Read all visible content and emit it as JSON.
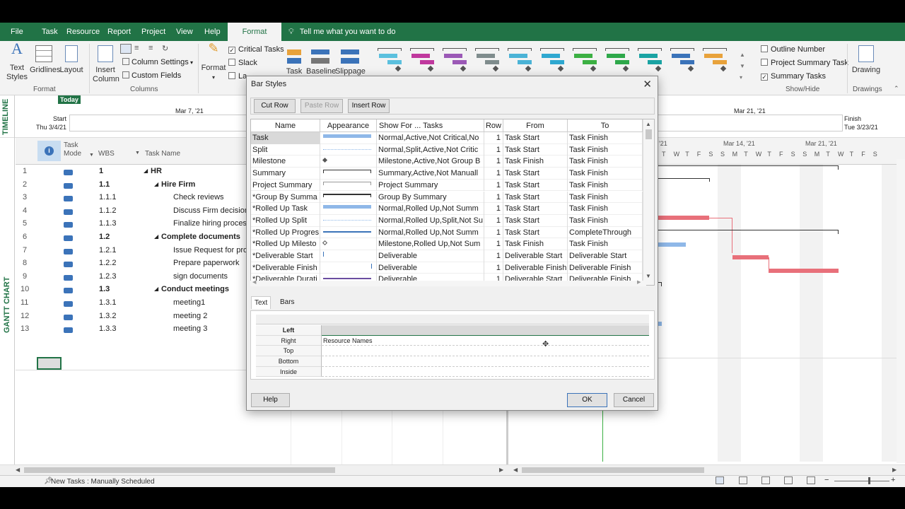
{
  "ribbon_tabs": [
    "File",
    "Task",
    "Resource",
    "Report",
    "Project",
    "View",
    "Help",
    "Format"
  ],
  "active_tab": "Format",
  "tell_me": "Tell me what you want to do",
  "ribbon": {
    "text_styles": "Text Styles",
    "gridlines": "Gridlines",
    "layout": "Layout",
    "insert_column": "Insert Column",
    "column_settings": "Column Settings",
    "custom_fields": "Custom Fields",
    "format": "Format",
    "critical_tasks": "Critical Tasks",
    "slack": "Slack",
    "late_tasks": "La",
    "task": "Task",
    "baseline": "Baseline",
    "slippage": "Slippage",
    "outline_number": "Outline Number",
    "project_summary_task": "Project Summary Task",
    "summary_tasks": "Summary Tasks",
    "drawing": "Drawing",
    "group_format": "Format",
    "group_columns": "Columns",
    "group_showhide": "Show/Hide",
    "group_drawings": "Drawings",
    "gantt_colors": [
      "#5bc0de",
      "#c0399e",
      "#9b59b6",
      "#7f8c8d",
      "#4bb3d6",
      "#2fa8d0",
      "#3cb043",
      "#2ea84a",
      "#1aa3a3",
      "#3b73b9",
      "#e8a23b"
    ]
  },
  "timeline": {
    "label": "TIMELINE",
    "today": "Today",
    "start_label": "Start",
    "start_date": "Thu 3/4/21",
    "mar7": "Mar 7, '21",
    "mar21": "Mar 21, '21",
    "finish_label": "Finish",
    "finish_date": "Tue 3/23/21"
  },
  "gantt_label": "GANTT CHART",
  "grid": {
    "headers": {
      "task_mode": "Task Mode",
      "wbs": "WBS",
      "task_name": "Task Name"
    },
    "rows": [
      {
        "id": "1",
        "wbs": "1",
        "name": "HR",
        "bold": true,
        "indent": 0,
        "summary": true
      },
      {
        "id": "2",
        "wbs": "1.1",
        "name": "Hire Firm",
        "bold": true,
        "indent": 1,
        "summary": true
      },
      {
        "id": "3",
        "wbs": "1.1.1",
        "name": "Check reviews",
        "bold": false,
        "indent": 2
      },
      {
        "id": "4",
        "wbs": "1.1.2",
        "name": "Discuss Firm decision w",
        "bold": false,
        "indent": 2
      },
      {
        "id": "5",
        "wbs": "1.1.3",
        "name": "Finalize hiring process",
        "bold": false,
        "indent": 2
      },
      {
        "id": "6",
        "wbs": "1.2",
        "name": "Complete documents",
        "bold": true,
        "indent": 1,
        "summary": true
      },
      {
        "id": "7",
        "wbs": "1.2.1",
        "name": "Issue Request for propo",
        "bold": false,
        "indent": 2
      },
      {
        "id": "8",
        "wbs": "1.2.2",
        "name": "Prepare paperwork",
        "bold": false,
        "indent": 2
      },
      {
        "id": "9",
        "wbs": "1.2.3",
        "name": "sign documents",
        "bold": false,
        "indent": 2
      },
      {
        "id": "10",
        "wbs": "1.3",
        "name": "Conduct meetings",
        "bold": true,
        "indent": 1,
        "summary": true
      },
      {
        "id": "11",
        "wbs": "1.3.1",
        "name": "meeting1",
        "bold": false,
        "indent": 2
      },
      {
        "id": "12",
        "wbs": "1.3.2",
        "name": "meeting 2",
        "bold": false,
        "indent": 2
      },
      {
        "id": "13",
        "wbs": "1.3.3",
        "name": "meeting 3",
        "bold": false,
        "indent": 2
      }
    ]
  },
  "gantt": {
    "week1": "'21",
    "week2": "Mar 14, '21",
    "week3": "Mar 21, '21",
    "days": [
      "T",
      "W",
      "T",
      "F",
      "S",
      "S",
      "M",
      "T",
      "W",
      "T",
      "F",
      "S",
      "S",
      "M",
      "T",
      "W",
      "T",
      "F",
      "S"
    ]
  },
  "dialog": {
    "title": "Bar Styles",
    "cut_row": "Cut Row",
    "paste_row": "Paste Row",
    "insert_row": "Insert Row",
    "columns": [
      "Name",
      "Appearance",
      "Show For ... Tasks",
      "Row",
      "From",
      "To"
    ],
    "rows": [
      {
        "name": "Task",
        "show": "Normal,Active,Not Critical,No",
        "row": "1",
        "from": "Task Start",
        "to": "Task Finish",
        "app": "task"
      },
      {
        "name": "Split",
        "show": "Normal,Split,Active,Not Critic",
        "row": "1",
        "from": "Task Start",
        "to": "Task Finish",
        "app": "split"
      },
      {
        "name": "Milestone",
        "show": "Milestone,Active,Not Group B",
        "row": "1",
        "from": "Task Finish",
        "to": "Task Finish",
        "app": "milestone"
      },
      {
        "name": "Summary",
        "show": "Summary,Active,Not Manuall",
        "row": "1",
        "from": "Task Start",
        "to": "Task Finish",
        "app": "summary"
      },
      {
        "name": "Project Summary",
        "show": "Project Summary",
        "row": "1",
        "from": "Task Start",
        "to": "Task Finish",
        "app": "projsummary"
      },
      {
        "name": "*Group By Summa",
        "show": "Group By Summary",
        "row": "1",
        "from": "Task Start",
        "to": "Task Finish",
        "app": "group"
      },
      {
        "name": "*Rolled Up Task",
        "show": "Normal,Rolled Up,Not Summ",
        "row": "1",
        "from": "Task Start",
        "to": "Task Finish",
        "app": "task"
      },
      {
        "name": "*Rolled Up Split",
        "show": "Normal,Rolled Up,Split,Not Su",
        "row": "1",
        "from": "Task Start",
        "to": "Task Finish",
        "app": "split"
      },
      {
        "name": "*Rolled Up Progres",
        "show": "Normal,Rolled Up,Not Summ",
        "row": "1",
        "from": "Task Start",
        "to": "CompleteThrough",
        "app": "progress"
      },
      {
        "name": "*Rolled Up Milesto",
        "show": "Milestone,Rolled Up,Not Sum",
        "row": "1",
        "from": "Task Finish",
        "to": "Task Finish",
        "app": "rmilestone"
      },
      {
        "name": "*Deliverable Start",
        "show": "Deliverable",
        "row": "1",
        "from": "Deliverable Start",
        "to": "Deliverable Start",
        "app": "dstart"
      },
      {
        "name": "*Deliverable Finish",
        "show": "Deliverable",
        "row": "1",
        "from": "Deliverable Finish",
        "to": "Deliverable Finish",
        "app": "dfinish"
      },
      {
        "name": "*Deliverable Durati",
        "show": "Deliverable",
        "row": "1",
        "from": "Deliverable Start",
        "to": "Deliverable Finish",
        "app": "dduration"
      }
    ],
    "tab_text": "Text",
    "tab_bars": "Bars",
    "positions": [
      {
        "label": "Left",
        "value": ""
      },
      {
        "label": "Right",
        "value": "Resource Names"
      },
      {
        "label": "Top",
        "value": ""
      },
      {
        "label": "Bottom",
        "value": ""
      },
      {
        "label": "Inside",
        "value": ""
      }
    ],
    "help": "Help",
    "ok": "OK",
    "cancel": "Cancel"
  },
  "status": {
    "new_tasks": "New Tasks : Manually Scheduled"
  }
}
